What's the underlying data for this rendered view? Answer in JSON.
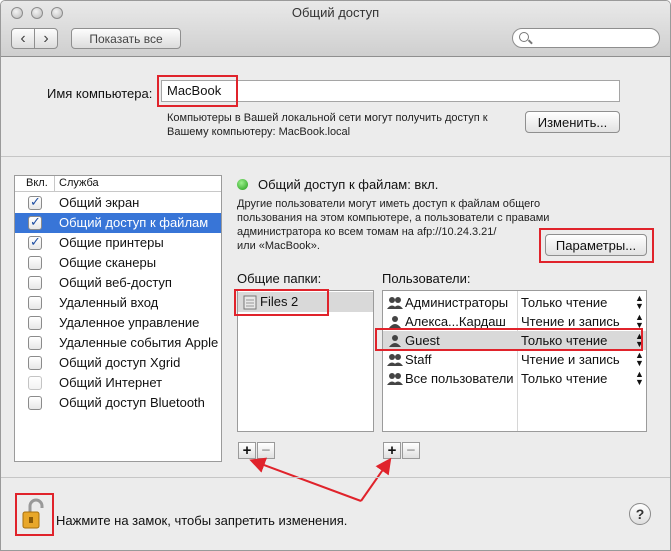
{
  "window": {
    "title": "Общий доступ"
  },
  "toolbar": {
    "show_all_label": "Показать все",
    "back_icon": "‹",
    "forward_icon": "›",
    "search_placeholder": ""
  },
  "computer": {
    "name_label": "Имя компьютера:",
    "name_value": "MacBook",
    "info_line1": "Компьютеры в Вашей локальной сети могут получить доступ к",
    "info_line2": "Вашему компьютеру: MacBook.local",
    "change_button": "Изменить..."
  },
  "services": {
    "header_on": "Вкл.",
    "header_service": "Служба",
    "items": [
      {
        "label": "Общий экран",
        "checked": true
      },
      {
        "label": "Общий доступ к файлам",
        "checked": true,
        "selected": true
      },
      {
        "label": "Общие принтеры",
        "checked": true
      },
      {
        "label": "Общие сканеры",
        "checked": false
      },
      {
        "label": "Общий веб-доступ",
        "checked": false
      },
      {
        "label": "Удаленный вход",
        "checked": false
      },
      {
        "label": "Удаленное управление",
        "checked": false
      },
      {
        "label": "Удаленные события Apple",
        "checked": false
      },
      {
        "label": "Общий доступ Xgrid",
        "checked": false
      },
      {
        "label": "Общий Интернет",
        "checked": false,
        "disabled": true
      },
      {
        "label": "Общий доступ Bluetooth",
        "checked": false
      }
    ]
  },
  "file_sharing": {
    "status": "Общий доступ к файлам: вкл.",
    "status_color": "#2fbf22",
    "desc_line1": "Другие пользователи могут иметь доступ к файлам общего",
    "desc_line2": "пользования на этом компьютере, а пользователи с правами",
    "desc_line3": "администратора ко всем томам на afp://10.24.3.21/",
    "desc_line4": "или «MacBook».",
    "options_button": "Параметры...",
    "shared_folders_label": "Общие папки:",
    "users_label": "Пользователи:",
    "folders": [
      "Files 2"
    ],
    "users": [
      {
        "name": "Администраторы",
        "perm": "Только чтение"
      },
      {
        "name": "Алекса...Кардаш",
        "perm": "Чтение и запись"
      },
      {
        "name": "Guest",
        "perm": "Только чтение",
        "selected": true
      },
      {
        "name": "Staff",
        "perm": "Чтение и запись"
      },
      {
        "name": "Все пользователи",
        "perm": "Только чтение"
      }
    ],
    "plus": "+",
    "minus": "−"
  },
  "footer": {
    "lock_text": "Нажмите на замок, чтобы запретить изменения.",
    "help": "?"
  },
  "annotation_color": "#e0232b"
}
